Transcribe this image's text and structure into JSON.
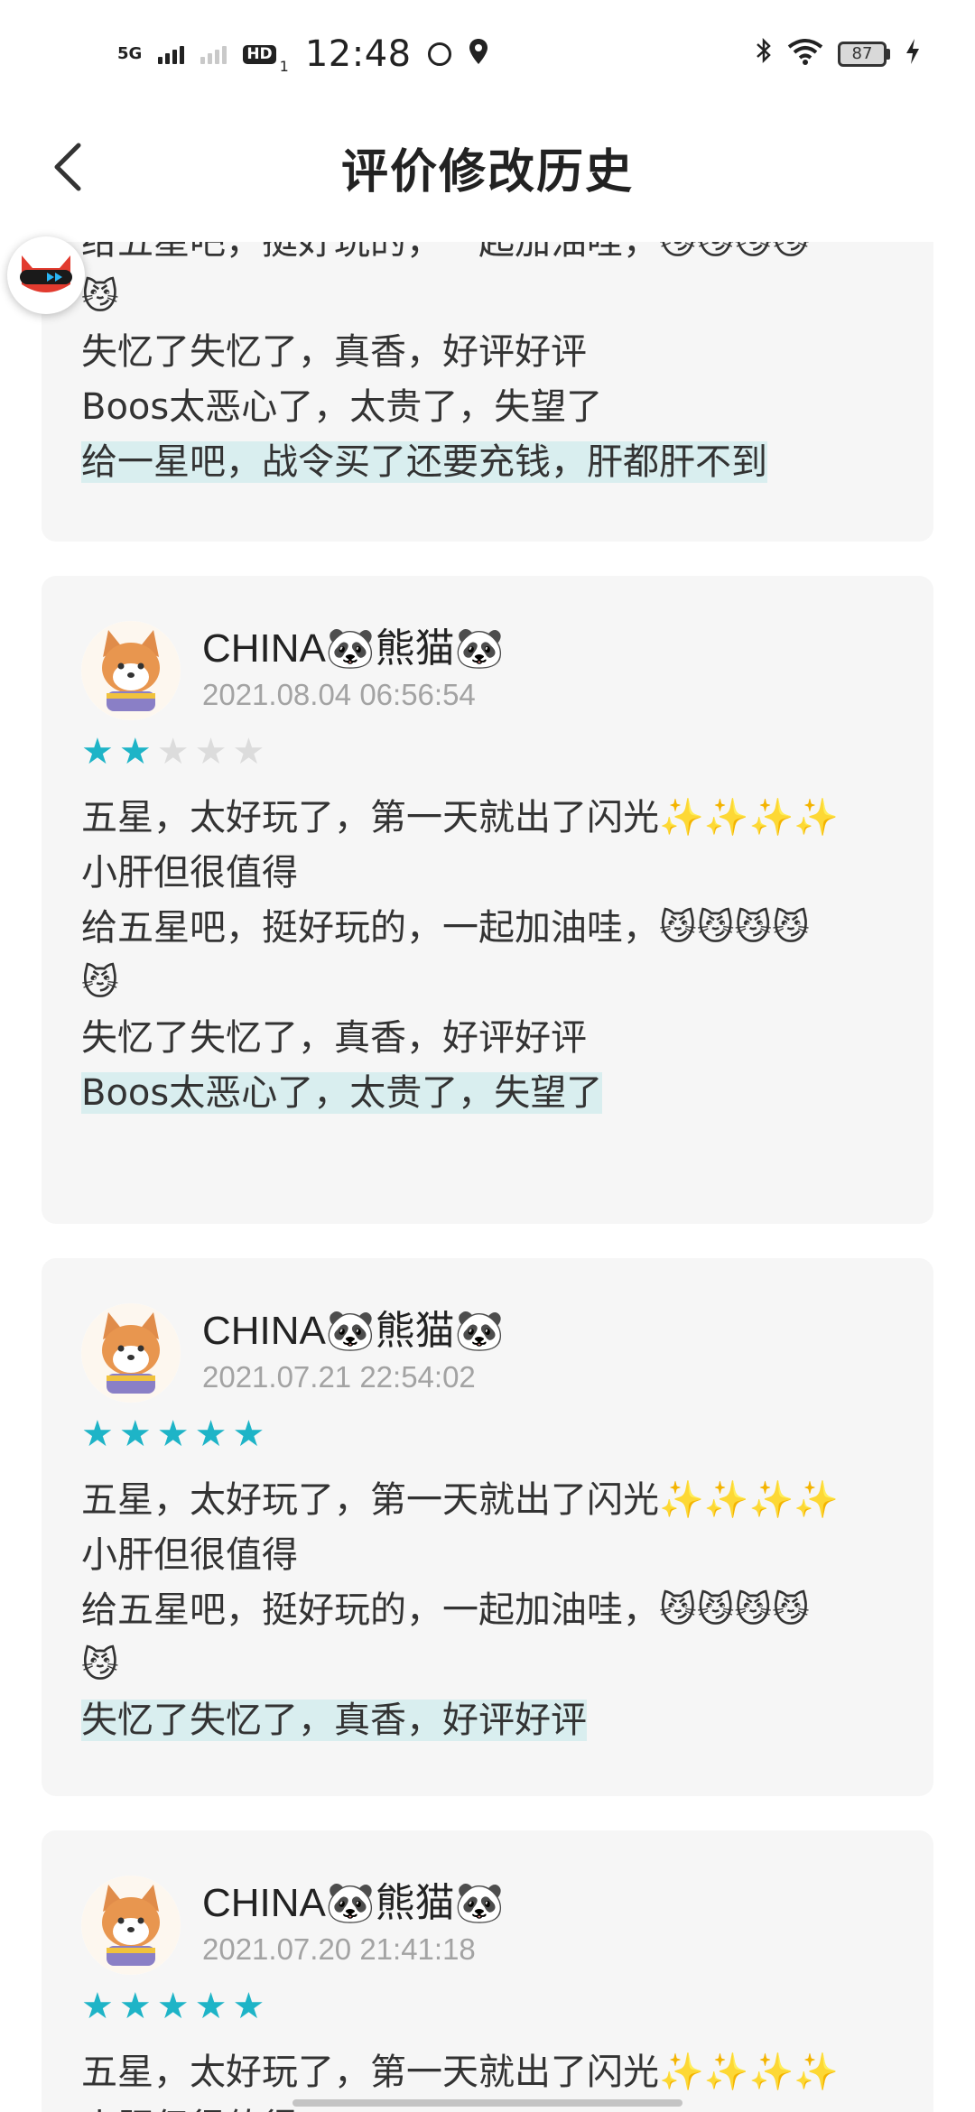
{
  "status_bar": {
    "network": "5G",
    "hd_label": "HD",
    "hd_sub": "1",
    "time": "12:48",
    "battery": "87"
  },
  "header": {
    "title": "评价修改历史"
  },
  "colors": {
    "star_active": "#1eb4c7",
    "star_inactive": "#dcdcdc",
    "highlight_bg": "#d9eeef",
    "card_bg": "#f6f6f6"
  },
  "partial_card": {
    "lines": [
      "给五星吧，挺好玩的，一起加油哇，😼😼😼😼",
      "😼",
      "失忆了失忆了，真香，好评好评",
      "Boos太恶心了，太贵了，失望了",
      "给一星吧，战令买了还要充钱，肝都肝不到"
    ]
  },
  "reviews": [
    {
      "username": "CHINA🐼熊猫🐼",
      "timestamp": "2021.08.04 06:56:54",
      "rating": 2,
      "lines": [
        "五星，太好玩了，第一天就出了闪光✨✨✨✨",
        "小肝但很值得",
        "给五星吧，挺好玩的，一起加油哇，😼😼😼😼",
        "😼",
        "失忆了失忆了，真香，好评好评",
        "Boos太恶心了，太贵了，失望了"
      ]
    },
    {
      "username": "CHINA🐼熊猫🐼",
      "timestamp": "2021.07.21 22:54:02",
      "rating": 5,
      "lines": [
        "五星，太好玩了，第一天就出了闪光✨✨✨✨",
        "小肝但很值得",
        "给五星吧，挺好玩的，一起加油哇，😼😼😼😼",
        "😼",
        "失忆了失忆了，真香，好评好评"
      ]
    },
    {
      "username": "CHINA🐼熊猫🐼",
      "timestamp": "2021.07.20 21:41:18",
      "rating": 5,
      "lines": [
        "五星，太好玩了，第一天就出了闪光✨✨✨✨",
        "小肝但很值得"
      ]
    }
  ]
}
